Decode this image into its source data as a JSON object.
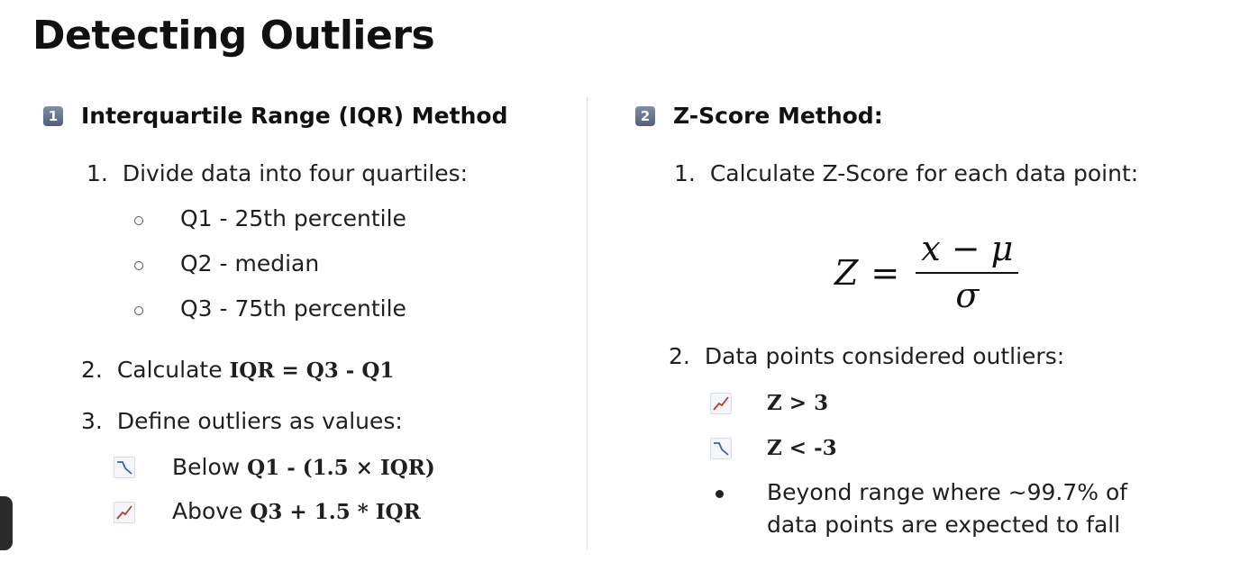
{
  "title": "Detecting Outliers",
  "iqr": {
    "badge": "1",
    "heading": "Interquartile Range (IQR) Method",
    "step1": {
      "num": "1.",
      "text": "Divide data into four quartiles:"
    },
    "quartiles": [
      "Q1 - 25th percentile",
      "Q2 - median",
      "Q3 - 75th percentile"
    ],
    "step2": {
      "num": "2.",
      "text": "Calculate ",
      "formula": "IQR = Q3 - Q1"
    },
    "step3": {
      "num": "3.",
      "text": "Define outliers as values:"
    },
    "below": {
      "text": "Below ",
      "formula": "Q1 - (1.5 × IQR)"
    },
    "above": {
      "text": "Above ",
      "formula": "Q3 + 1.5 * IQR"
    }
  },
  "zscore": {
    "badge": "2",
    "heading": "Z-Score Method:",
    "step1": {
      "num": "1.",
      "text": "Calculate Z-Score for each data point:"
    },
    "formula": {
      "lhs": "Z",
      "eq": "=",
      "numerator": "x − μ",
      "denominator": "σ"
    },
    "step2": {
      "num": "2.",
      "text": "Data points considered outliers:"
    },
    "cond_gt": "Z > 3",
    "cond_lt": "Z < -3",
    "beyond_line1": "Beyond range where ~99.7% of",
    "beyond_line2": "data points are expected to fall"
  },
  "colors": {
    "trend_down": "#3b5fa8",
    "trend_up": "#c0392b",
    "divider": "#dddddd"
  }
}
